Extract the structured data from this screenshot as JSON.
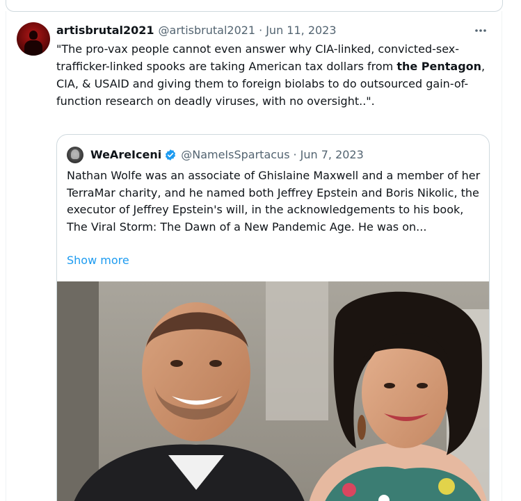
{
  "tweet": {
    "author": {
      "display_name": "artisbrutal2021",
      "handle": "@artisbrutal2021",
      "separator": "·",
      "date": "Jun 11, 2023"
    },
    "more_icon": "more-horizontal-icon",
    "text": {
      "part1": "\"The pro-vax people cannot even answer why CIA-linked, convicted-sex-trafficker-linked spooks are taking American tax dollars from ",
      "bold": "the Pentagon",
      "part2": ", CIA, & USAID and giving them to foreign biolabs to do outsourced gain-of-function research on deadly viruses, with no oversight..\"."
    }
  },
  "quote": {
    "author": {
      "display_name": "WeAreIceni",
      "verified_icon": "verified-badge-icon",
      "handle": "@NameIsSpartacus",
      "separator": "·",
      "date": "Jun 7, 2023"
    },
    "text": "Nathan Wolfe was an associate of Ghislaine Maxwell and a member of her TerraMar charity, and he named both Jeffrey Epstein and Boris Nikolic, the executor of Jeffrey Epstein's will, in the acknowledgements to his book, The Viral Storm: The Dawn of a New Pandemic Age. He was on...",
    "show_more_label": "Show more"
  },
  "colors": {
    "text_primary": "#0f1419",
    "text_secondary": "#536471",
    "link": "#1d9bf0",
    "border": "#cfd9de"
  }
}
